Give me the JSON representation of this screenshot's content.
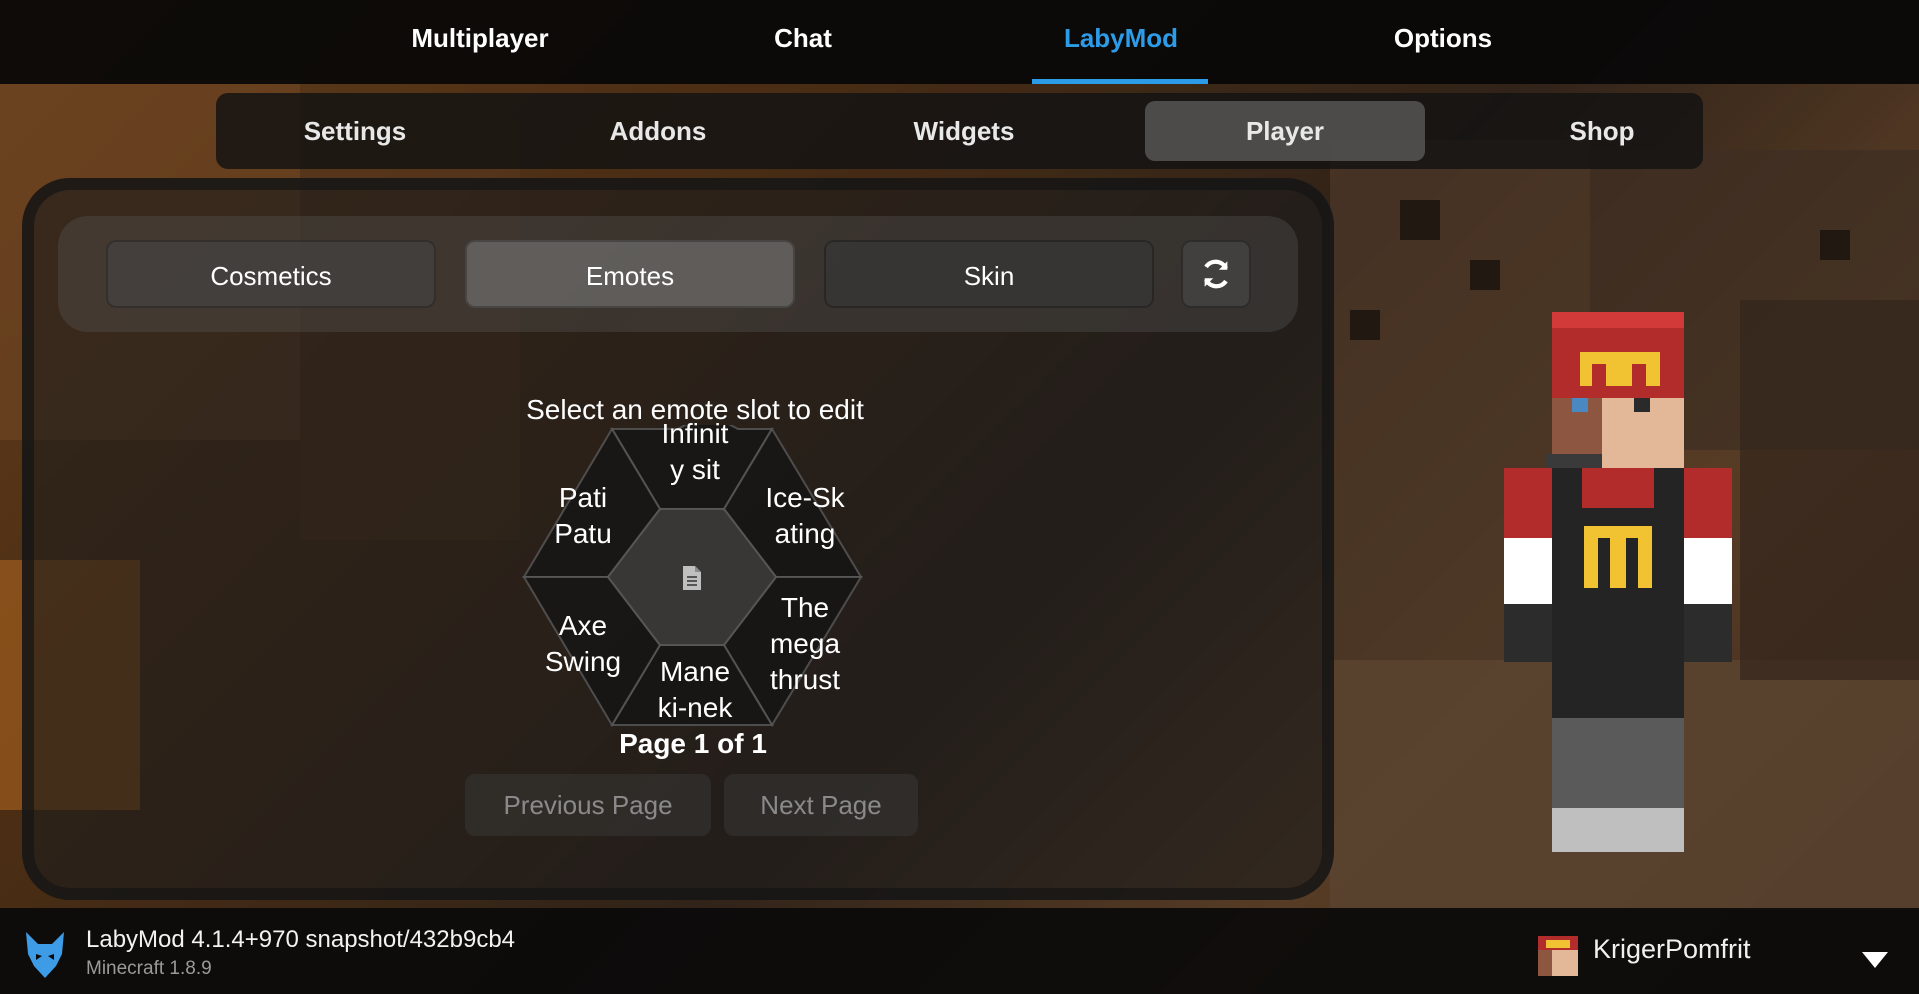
{
  "top_nav": {
    "tabs": [
      "Multiplayer",
      "Chat",
      "LabyMod",
      "Options"
    ],
    "active": "LabyMod"
  },
  "sub_nav": {
    "tabs": [
      "Settings",
      "Addons",
      "Widgets",
      "Player",
      "Shop"
    ],
    "active": "Player"
  },
  "category_tabs": {
    "items": [
      "Cosmetics",
      "Emotes",
      "Skin"
    ],
    "refresh_icon": "refresh-icon"
  },
  "emote_wheel": {
    "instruction": "Select an emote slot to edit",
    "slots": {
      "top": [
        "Infinit",
        "y sit"
      ],
      "top_right": [
        "Ice-Sk",
        "ating"
      ],
      "bottom_right": [
        "The",
        "mega",
        "thrust"
      ],
      "bottom": [
        "Mane",
        "ki-nek"
      ],
      "bottom_left": [
        "Axe",
        "Swing"
      ],
      "top_left": [
        "Pati",
        "Patu"
      ]
    },
    "center_icon": "document-icon",
    "page_label": "Page 1 of 1",
    "previous_label": "Previous Page",
    "next_label": "Next Page"
  },
  "footer": {
    "title": "LabyMod 4.1.4+970 snapshot/432b9cb4",
    "subtitle": "Minecraft 1.8.9",
    "username": "KrigerPomfrit",
    "logo_icon": "wolf-logo-icon",
    "dropdown_icon": "chevron-down-icon"
  },
  "colors": {
    "accent": "#2d9ce8"
  }
}
